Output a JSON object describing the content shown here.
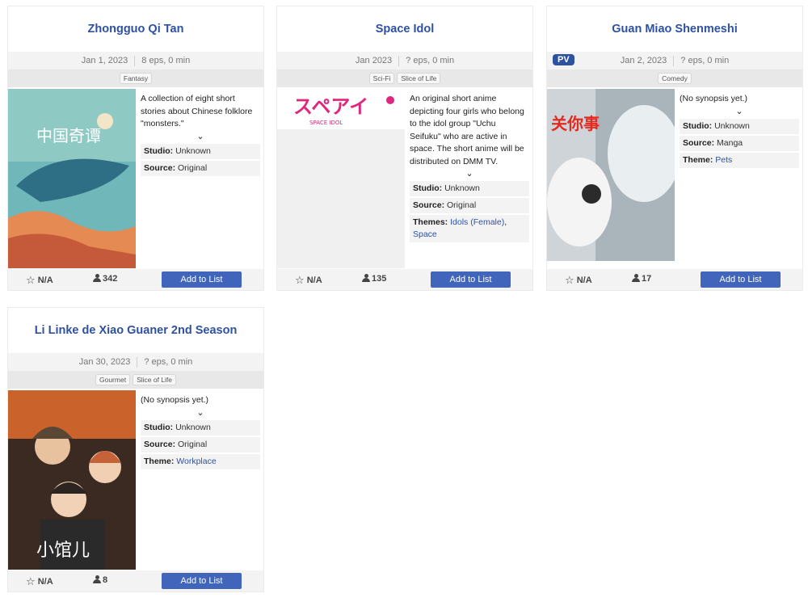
{
  "cards": [
    {
      "title": "Zhongguo Qi Tan",
      "date": "Jan 1, 2023",
      "eps": "8 eps, 0 min",
      "genres": [
        "Fantasy"
      ],
      "synopsis": "A collection of eight short stories about Chinese folklore \"monsters.\"",
      "studio_label": "Studio:",
      "studio": "Unknown",
      "source_label": "Source:",
      "source": "Original",
      "score": "N/A",
      "members": "342",
      "button": "Add to List",
      "colors": {
        "sky": "#5aa9b0",
        "whale": "#2f6f86",
        "ground": "#e58a52"
      }
    },
    {
      "title": "Space Idol",
      "date": "Jan 2023",
      "eps": "? eps, 0 min",
      "genres": [
        "Sci-Fi",
        "Slice of Life"
      ],
      "synopsis": "An original short anime depicting four girls who belong to the idol group \"Uchu Seifuku\" who are active in space. The short anime will be distributed on DMM TV.",
      "studio_label": "Studio:",
      "studio": "Unknown",
      "source_label": "Source:",
      "source": "Original",
      "themes_label": "Themes:",
      "theme1": "Idols (Female)",
      "theme2": "Space",
      "logo_text": "スペアイ",
      "logo_sub": "SPACE IDOL",
      "score": "N/A",
      "members": "135",
      "button": "Add to List",
      "colors": {
        "logo": "#e0267d"
      }
    },
    {
      "title": "Guan Miao Shenmeshi",
      "pv": "PV",
      "date": "Jan 2, 2023",
      "eps": "? eps, 0 min",
      "genres": [
        "Comedy"
      ],
      "synopsis": "(No synopsis yet.)",
      "studio_label": "Studio:",
      "studio": "Unknown",
      "source_label": "Source:",
      "source": "Manga",
      "theme_label": "Theme:",
      "theme": "Pets",
      "logo_text": "关你事",
      "score": "N/A",
      "members": "17",
      "button": "Add to List",
      "colors": {
        "logo": "#e32a20"
      }
    },
    {
      "title": "Li Linke de Xiao Guaner 2nd Season",
      "date": "Jan 30, 2023",
      "eps": "? eps, 0 min",
      "genres": [
        "Gourmet",
        "Slice of Life"
      ],
      "synopsis": "(No synopsis yet.)",
      "studio_label": "Studio:",
      "studio": "Unknown",
      "source_label": "Source:",
      "source": "Original",
      "theme_label": "Theme:",
      "theme": "Workplace",
      "logo_text": "小馆儿",
      "score": "N/A",
      "members": "8",
      "button": "Add to List",
      "colors": {
        "bg": "#3b2a22",
        "fire": "#c9622b"
      }
    }
  ]
}
